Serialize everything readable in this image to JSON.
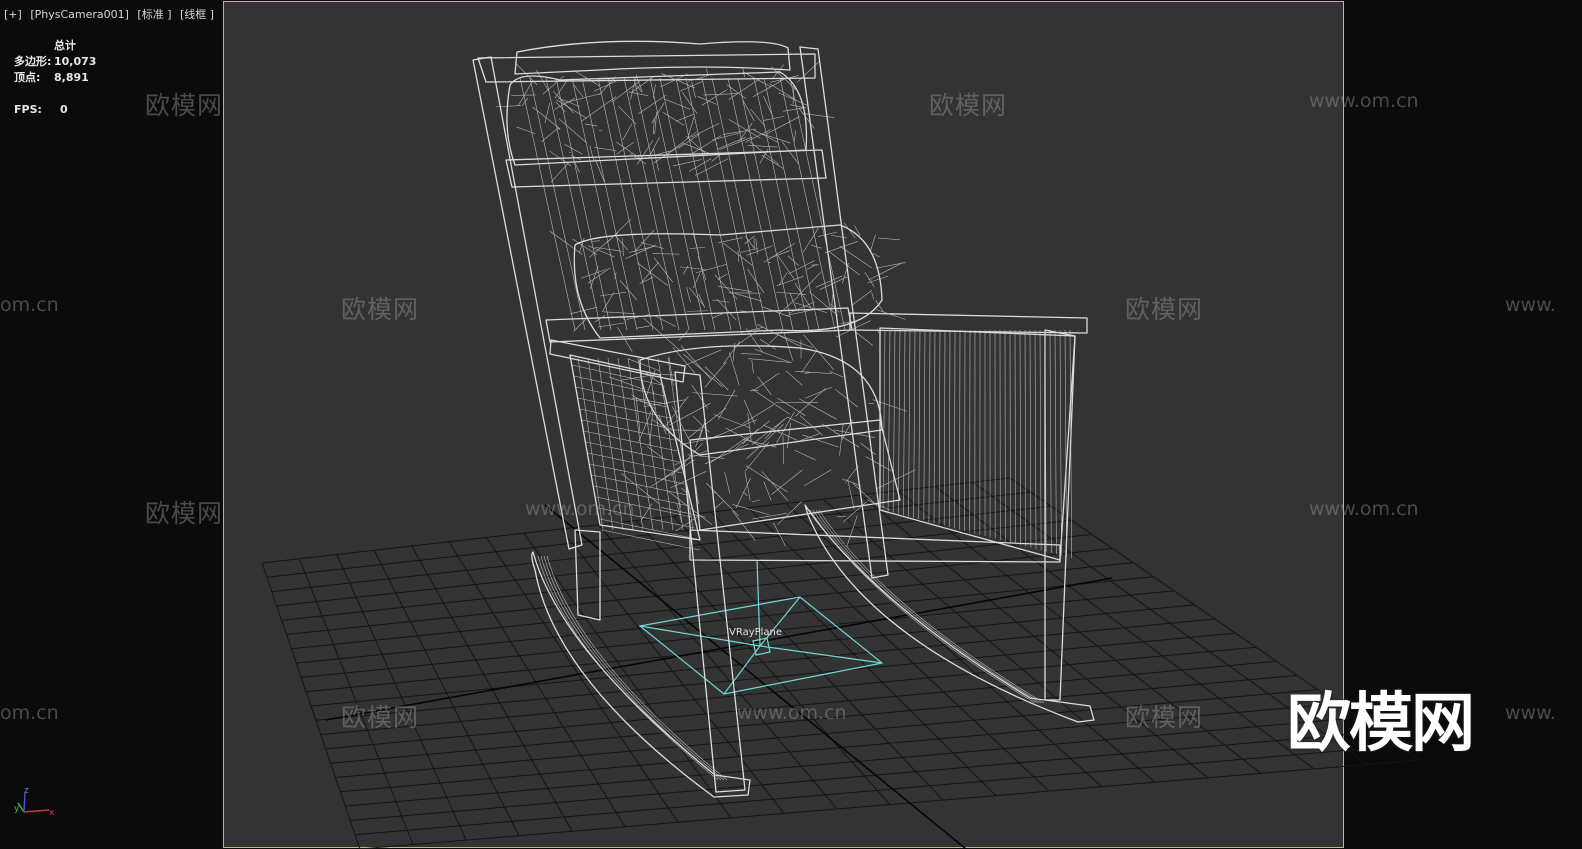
{
  "viewport": {
    "label_items": [
      "[+]",
      "[PhysCamera001]",
      "[标准 ]",
      "[线框 ]"
    ],
    "stats": {
      "header": "总计",
      "polygons_label": "多边形:",
      "polygons_value": "10,073",
      "vertices_label": "顶点:",
      "vertices_value": "8,891",
      "fps_label": "FPS:",
      "fps_value": "0"
    },
    "object_label": "VRayPlane",
    "axis_labels": {
      "x": "x",
      "y": "y",
      "z": "z"
    }
  },
  "watermarks": {
    "cn_text": "欧模网",
    "url_text": "www.om.cn",
    "url_partial_left": "om.cn",
    "url_partial_right": "www.",
    "logo_text": "欧模网"
  },
  "colors": {
    "viewport_bg": "#333333",
    "outer_bg": "#0b0b0b",
    "safe_frame": "#c9c22a",
    "wireframe": "#e8e8e8",
    "grid": "#111111",
    "vray_plane": "#6fd6d6",
    "axis_x": "#d23a3a",
    "axis_y": "#3ac23a",
    "axis_z": "#3a5fd2"
  },
  "icons": {
    "axis_gizmo": "axis-tripod-icon"
  }
}
